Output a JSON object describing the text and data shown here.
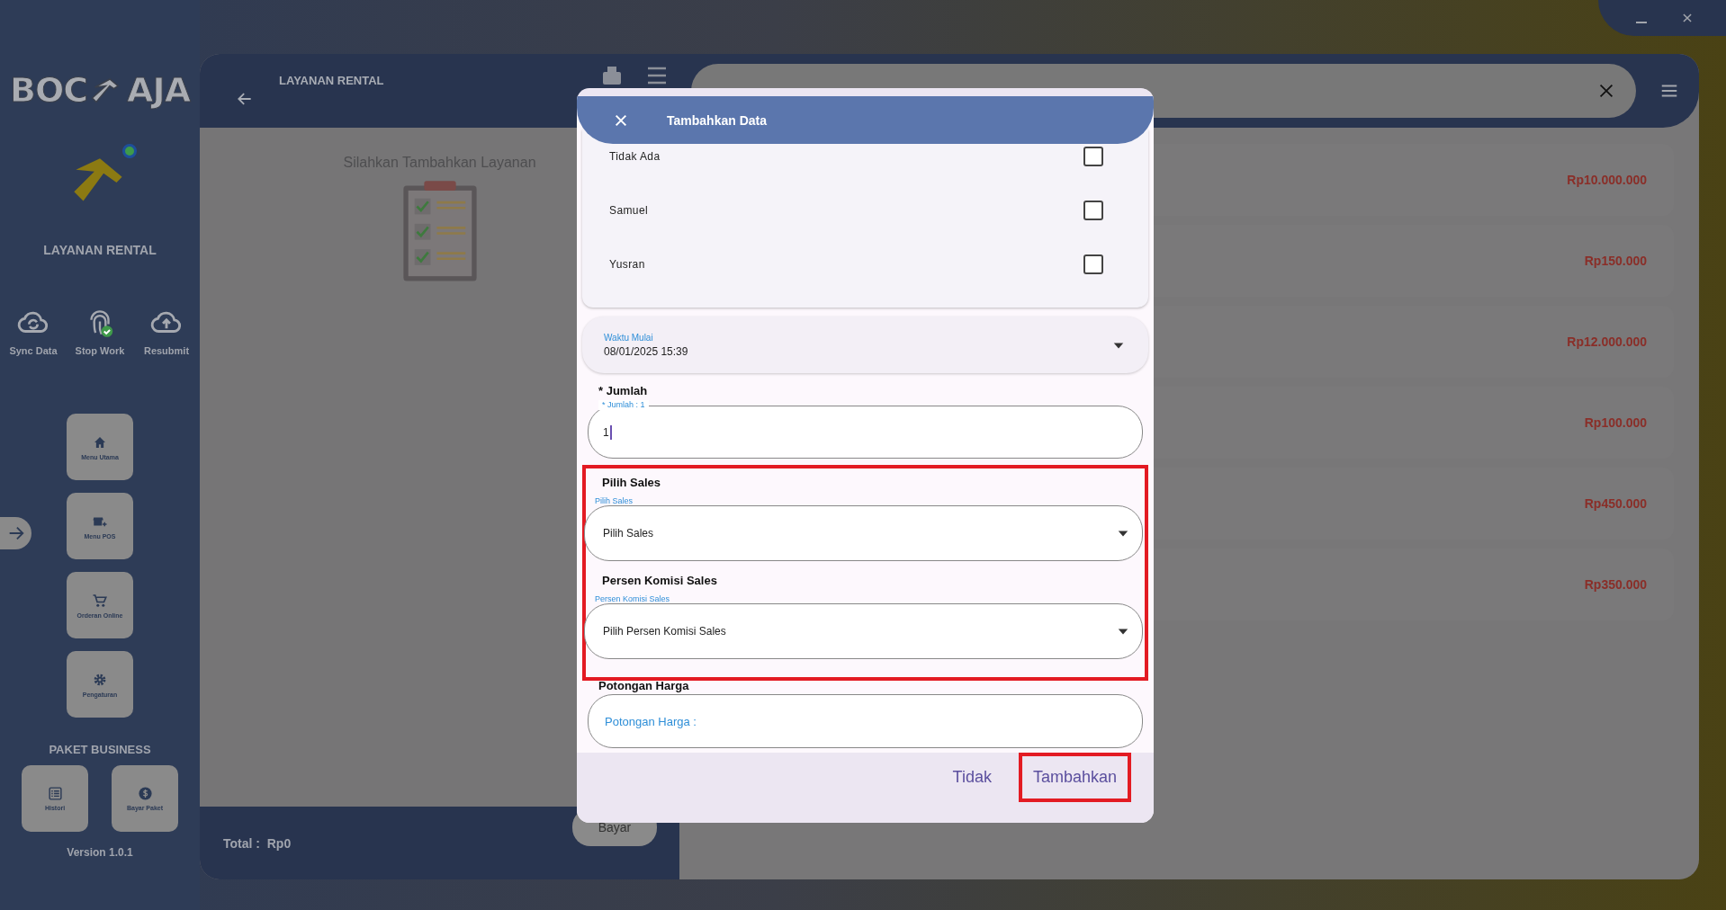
{
  "sidebar": {
    "logo": {
      "left": "BOC",
      "right": "AJA"
    },
    "module_title": "LAYANAN RENTAL",
    "actions": [
      {
        "label": "Sync Data",
        "kind": "sync"
      },
      {
        "label": "Stop Work",
        "kind": "fingerprint"
      },
      {
        "label": "Resubmit",
        "kind": "upload"
      }
    ],
    "menu": [
      {
        "label": "Menu Utama",
        "kind": "home"
      },
      {
        "label": "Menu POS",
        "kind": "store"
      },
      {
        "label": "Orderan Online",
        "kind": "cart"
      },
      {
        "label": "Pengaturan",
        "kind": "gear"
      }
    ],
    "package_title": "PAKET BUSINESS",
    "package_buttons": [
      {
        "label": "Histori",
        "kind": "list"
      },
      {
        "label": "Bayar Paket",
        "kind": "dollar"
      }
    ],
    "version": "Version 1.0.1"
  },
  "cart": {
    "title": "LAYANAN RENTAL",
    "empty_message": "Silahkan Tambahkan Layanan",
    "total_label": "Total :",
    "total_value": "Rp0",
    "pay_button": "Bayar"
  },
  "catalog": {
    "prices": [
      "Rp10.000.000",
      "Rp150.000",
      "Rp12.000.000",
      "Rp100.000",
      "Rp450.000",
      "Rp350.000"
    ]
  },
  "dialog": {
    "title": "Tambahkan Data",
    "options": [
      {
        "label": "Tidak Ada",
        "checked": false
      },
      {
        "label": "Samuel",
        "checked": false
      },
      {
        "label": "Yusran",
        "checked": false
      }
    ],
    "start_time": {
      "label": "Waktu Mulai",
      "value": "08/01/2025 15:39"
    },
    "quantity": {
      "heading": "* Jumlah",
      "label": "* Jumlah : 1",
      "value": "1"
    },
    "sales_section": {
      "highlighted": true,
      "fields": [
        {
          "heading": "Pilih Sales",
          "label": "Pilih Sales",
          "value": "Pilih Sales"
        },
        {
          "heading": "Persen Komisi Sales",
          "label": "Persen Komisi Sales",
          "value": "Pilih Persen Komisi Sales"
        }
      ]
    },
    "discount": {
      "heading": "Potongan Harga",
      "placeholder": "Potongan Harga :"
    },
    "buttons": [
      {
        "label": "Tidak",
        "highlighted": false
      },
      {
        "label": "Tambahkan",
        "highlighted": true
      }
    ]
  }
}
